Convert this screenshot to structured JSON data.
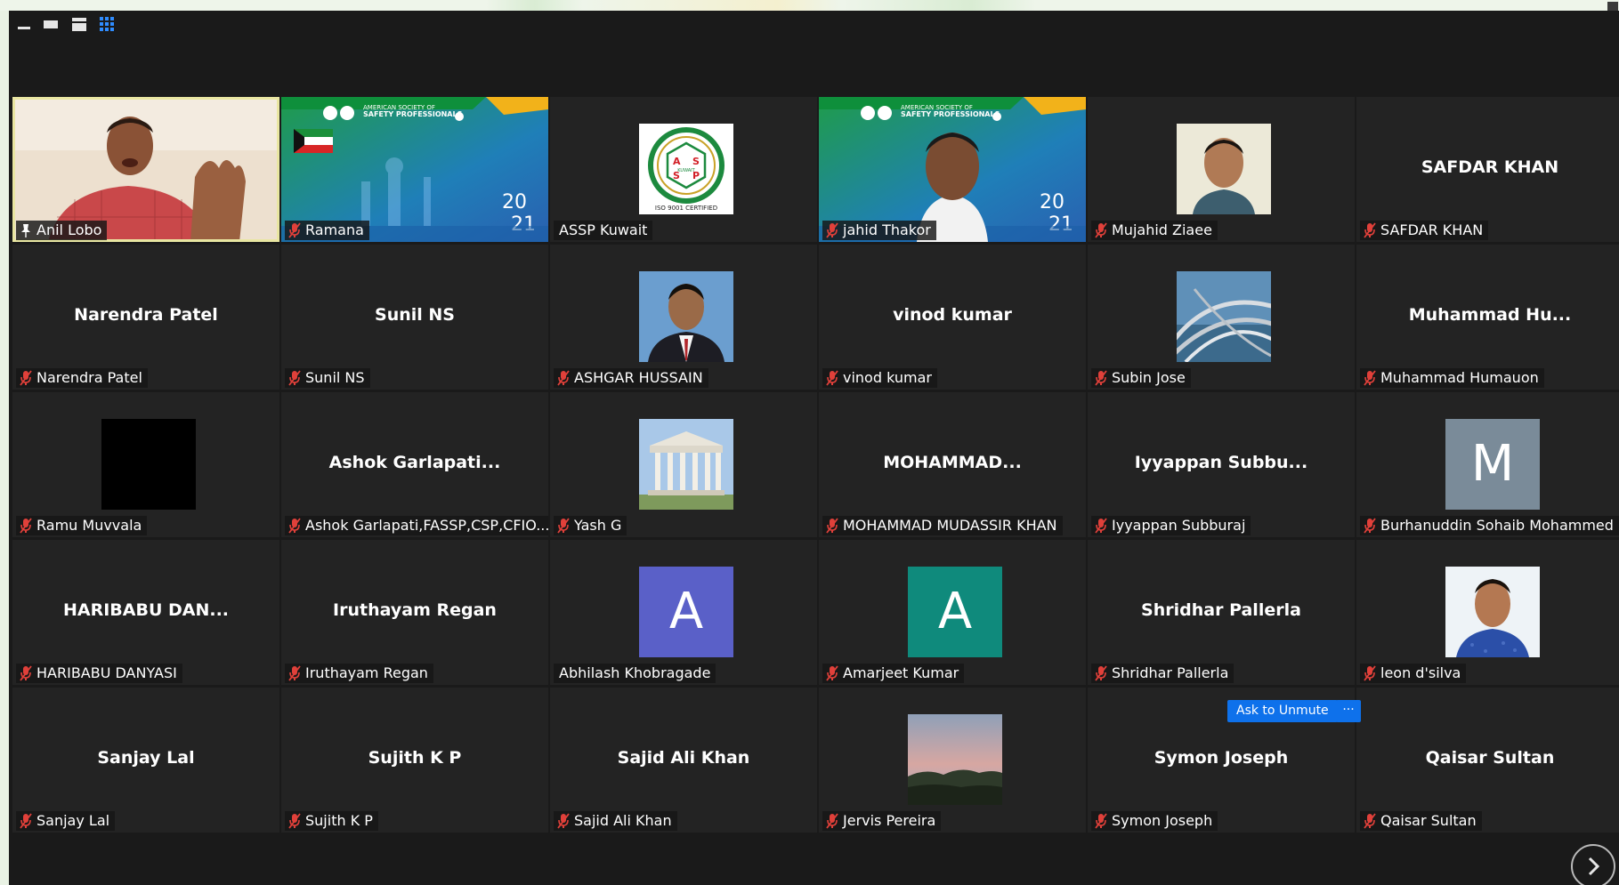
{
  "view_toolbar": {
    "buttons": [
      "minimize-view",
      "strip-view",
      "speaker-view",
      "gallery-view"
    ]
  },
  "tiles": [
    {
      "label": "Anil Lobo",
      "kind": "video",
      "pinned": true,
      "speaking": true
    },
    {
      "label": "Ramana",
      "kind": "banner",
      "muted": true
    },
    {
      "label": "ASSP Kuwait",
      "kind": "logo",
      "muted": false
    },
    {
      "label": "jahid Thakor",
      "kind": "banner-video",
      "muted": true
    },
    {
      "label": "Mujahid Ziaee",
      "kind": "photo",
      "muted": true
    },
    {
      "label": "SAFDAR KHAN",
      "display": "SAFDAR KHAN",
      "kind": "name",
      "muted": true
    },
    {
      "label": "Narendra Patel",
      "display": "Narendra Patel",
      "kind": "name",
      "muted": true
    },
    {
      "label": "Sunil NS",
      "display": "Sunil NS",
      "kind": "name",
      "muted": true
    },
    {
      "label": "ASHGAR HUSSAIN",
      "kind": "photo",
      "muted": true
    },
    {
      "label": "vinod kumar",
      "display": "vinod kumar",
      "kind": "name",
      "muted": true
    },
    {
      "label": "Subin Jose",
      "kind": "photo",
      "muted": true
    },
    {
      "label": "Muhammad Humauon",
      "display": "Muhammad  Hu...",
      "kind": "name",
      "muted": true
    },
    {
      "label": "Ramu Muvvala",
      "kind": "black",
      "muted": true
    },
    {
      "label": "Ashok Garlapati,FASSP,CSP,CFIO...",
      "display": "Ashok  Garlapati...",
      "kind": "name",
      "muted": true
    },
    {
      "label": "Yash G",
      "kind": "photo",
      "muted": true
    },
    {
      "label": "MOHAMMAD MUDASSIR KHAN",
      "display": "MOHAMMAD...",
      "kind": "name",
      "muted": true
    },
    {
      "label": "Iyyappan Subburaj",
      "display": "Iyyappan  Subbu...",
      "kind": "name",
      "muted": true
    },
    {
      "label": "Burhanuddin Sohaib Mohammed",
      "kind": "letter",
      "letter": "M",
      "color": "#7a8b99",
      "muted": true
    },
    {
      "label": "HARIBABU DANYASI",
      "display": "HARIBABU DAN...",
      "kind": "name",
      "muted": true
    },
    {
      "label": "Iruthayam Regan",
      "display": "Iruthayam Regan",
      "kind": "name",
      "muted": true
    },
    {
      "label": "Abhilash Khobragade",
      "kind": "letter",
      "letter": "A",
      "color": "#5a60c8",
      "muted": false
    },
    {
      "label": "Amarjeet Kumar",
      "kind": "letter",
      "letter": "A",
      "color": "#0f8a7c",
      "muted": true
    },
    {
      "label": "Shridhar Pallerla",
      "display": "Shridhar Pallerla",
      "kind": "name",
      "muted": true
    },
    {
      "label": "leon d'silva",
      "kind": "photo",
      "muted": true
    },
    {
      "label": "Sanjay Lal",
      "display": "Sanjay Lal",
      "kind": "name",
      "muted": true
    },
    {
      "label": "Sujith K P",
      "display": "Sujith K P",
      "kind": "name",
      "muted": true
    },
    {
      "label": "Sajid Ali Khan",
      "display": "Sajid Ali Khan",
      "kind": "name",
      "muted": true
    },
    {
      "label": "Jervis Pereira",
      "kind": "photo",
      "muted": true
    },
    {
      "label": "Symon Joseph",
      "display": "Symon Joseph",
      "kind": "name",
      "muted": true
    },
    {
      "label": "Qaisar Sultan",
      "display": "Qaisar Sultan",
      "kind": "name",
      "muted": true
    }
  ],
  "controls": {
    "ask_to_unmute": "Ask to Unmute",
    "more": "···"
  },
  "banner": {
    "org_line1": "AMERICAN SOCIETY OF",
    "org_line2": "SAFETY PROFESSIONALS",
    "year_top": "20",
    "year_bottom": "21"
  },
  "logo": {
    "ring_text": "AMERICAN SOCIETY OF SAFETY PROFESSIONALS",
    "center": "KUWAIT",
    "letters": [
      "A",
      "S",
      "S",
      "P"
    ],
    "iso": "ISO 9001 CERTIFIED"
  },
  "colors": {
    "background": "#1a1a1a",
    "tile": "#232323",
    "speaker_outline": "#e9e6a2",
    "muted_icon": "#e0403a",
    "accent": "#0e71eb"
  }
}
